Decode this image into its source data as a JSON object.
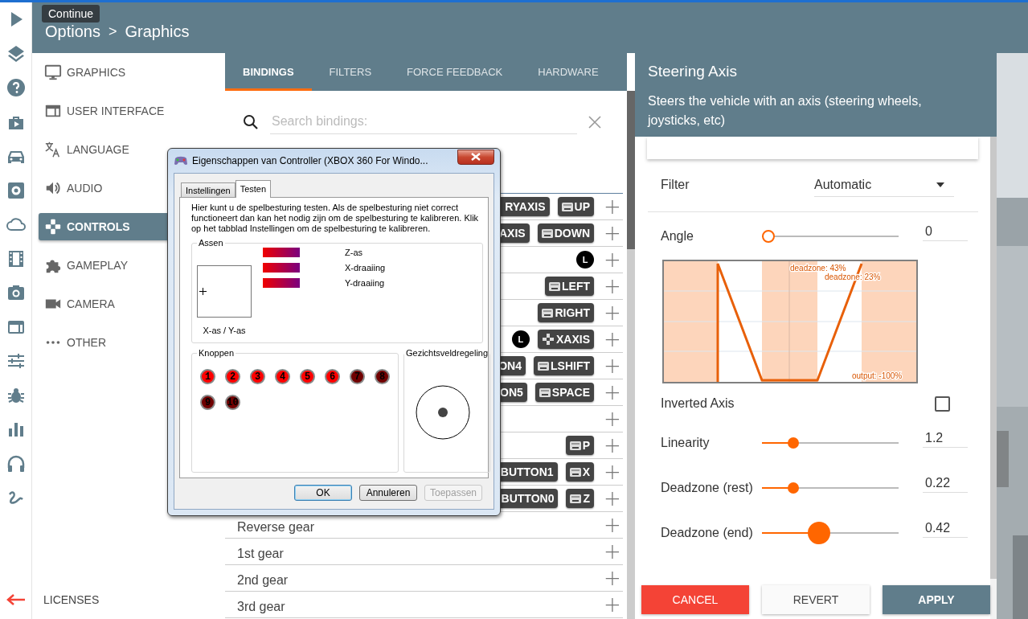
{
  "tooltip": "Continue",
  "header": {
    "breadcrumb": [
      "Options",
      ">",
      "Graphics"
    ]
  },
  "categories": [
    {
      "label": "GRAPHICS",
      "selected": false
    },
    {
      "label": "USER INTERFACE",
      "selected": false
    },
    {
      "label": "LANGUAGE",
      "selected": false
    },
    {
      "label": "AUDIO",
      "selected": false
    },
    {
      "label": "CONTROLS",
      "selected": true
    },
    {
      "label": "GAMEPLAY",
      "selected": false
    },
    {
      "label": "CAMERA",
      "selected": false
    },
    {
      "label": "OTHER",
      "selected": false
    }
  ],
  "licenses": "LICENSES",
  "tabs": [
    {
      "label": "BINDINGS",
      "selected": true
    },
    {
      "label": "FILTERS",
      "selected": false
    },
    {
      "label": "FORCE FEEDBACK",
      "selected": false
    },
    {
      "label": "HARDWARE",
      "selected": false
    }
  ],
  "search": {
    "placeholder": "Search bindings:"
  },
  "bindings": [
    {
      "keys": [
        {
          "kind": "partial",
          "label": "RYAXIS"
        },
        {
          "kind": "keyboard",
          "label": "UP"
        }
      ],
      "add": "+"
    },
    {
      "keys": [
        {
          "kind": "partial",
          "label": "AXIS"
        },
        {
          "kind": "keyboard",
          "label": "DOWN"
        }
      ],
      "add": "+"
    },
    {
      "keys": [
        {
          "kind": "stick-vertical",
          "label": "L"
        }
      ],
      "add": "+"
    },
    {
      "keys": [
        {
          "kind": "keyboard",
          "label": "LEFT"
        }
      ],
      "add": "+"
    },
    {
      "keys": [
        {
          "kind": "keyboard",
          "label": "RIGHT"
        }
      ],
      "add": "+"
    },
    {
      "keys": [
        {
          "kind": "stick-horizontal",
          "label": "L"
        },
        {
          "kind": "gamepad",
          "label": "XAXIS"
        }
      ],
      "add": "+"
    },
    {
      "keys": [
        {
          "kind": "partial",
          "label": "ON4"
        },
        {
          "kind": "keyboard",
          "label": "LSHIFT"
        }
      ],
      "add": "+"
    },
    {
      "keys": [
        {
          "kind": "partial",
          "label": "ON5"
        },
        {
          "kind": "keyboard",
          "label": "SPACE"
        }
      ],
      "add": "+"
    },
    {
      "add": "+"
    },
    {
      "keys": [
        {
          "kind": "keyboard",
          "label": "P"
        }
      ],
      "add": "+"
    },
    {
      "keys": [
        {
          "kind": "partial",
          "label": "BUTTON1"
        },
        {
          "kind": "keyboard",
          "label": "X"
        }
      ],
      "add": "+"
    },
    {
      "keys": [
        {
          "kind": "partial",
          "label": "BUTTON0"
        },
        {
          "kind": "keyboard",
          "label": "Z"
        }
      ],
      "add": "+"
    },
    {
      "name": "Reverse gear",
      "add": "+"
    },
    {
      "name": "1st gear",
      "add": "+"
    },
    {
      "name": "2nd gear",
      "add": "+"
    },
    {
      "name": "3rd gear",
      "add": "+"
    }
  ],
  "axis_panel": {
    "title": "Steering Axis",
    "description": "Steers the vehicle with an axis (steering wheels, joysticks, etc)",
    "filter": {
      "label": "Filter",
      "value": "Automatic"
    },
    "angle": {
      "label": "Angle",
      "level": 0,
      "value": "0"
    },
    "curve": {
      "labels": [
        "deadzone: 43%",
        "deadzone: 23%",
        "output: -100%"
      ]
    },
    "inverted": {
      "label": "Inverted Axis",
      "checked": false
    },
    "sliders": [
      {
        "label": "Linearity",
        "level": 0.23,
        "value": "1.2",
        "focused": false
      },
      {
        "label": "Deadzone (rest)",
        "level": 0.23,
        "value": "0.22",
        "focused": false
      },
      {
        "label": "Deadzone (end)",
        "level": 0.42,
        "value": "0.42",
        "focused": true
      }
    ],
    "buttons": [
      {
        "label": "CANCEL",
        "kind": "cancel"
      },
      {
        "label": "REVERT",
        "kind": "revert"
      },
      {
        "label": "APPLY",
        "kind": "apply"
      }
    ]
  },
  "dialog": {
    "title": "Eigenschappen van Controller (XBOX 360 For Windo...",
    "tabs": [
      {
        "label": "Instellingen",
        "selected": false
      },
      {
        "label": "Testen",
        "selected": true
      }
    ],
    "intro": "Hier kunt u de spelbesturing testen. Als de spelbesturing niet correct functioneert dan kan het nodig zijn om de spelbesturing te kalibreren. Klik op het tabblad Instellingen om de spelbesturing te kalibreren.",
    "axes": {
      "title": "Assen",
      "xy_label": "X-as / Y-as",
      "bars": [
        "Z-as",
        "X-draaiing",
        "Y-draaiing"
      ]
    },
    "buttons_group": {
      "title": "Knoppen",
      "buttons": [
        {
          "label": "1",
          "pressed": true
        },
        {
          "label": "2",
          "pressed": true
        },
        {
          "label": "3",
          "pressed": true
        },
        {
          "label": "4",
          "pressed": true
        },
        {
          "label": "5",
          "pressed": true
        },
        {
          "label": "6",
          "pressed": true
        },
        {
          "label": "7",
          "pressed": false
        },
        {
          "label": "8",
          "pressed": false
        },
        {
          "label": "9",
          "pressed": false
        },
        {
          "label": "10",
          "pressed": false
        }
      ]
    },
    "pov": {
      "title": "Gezichtsveldregeling"
    },
    "actions": [
      {
        "label": "OK",
        "kind": "default"
      },
      {
        "label": "Annuleren",
        "kind": "normal"
      },
      {
        "label": "Toepassen",
        "kind": "disabled"
      }
    ]
  }
}
